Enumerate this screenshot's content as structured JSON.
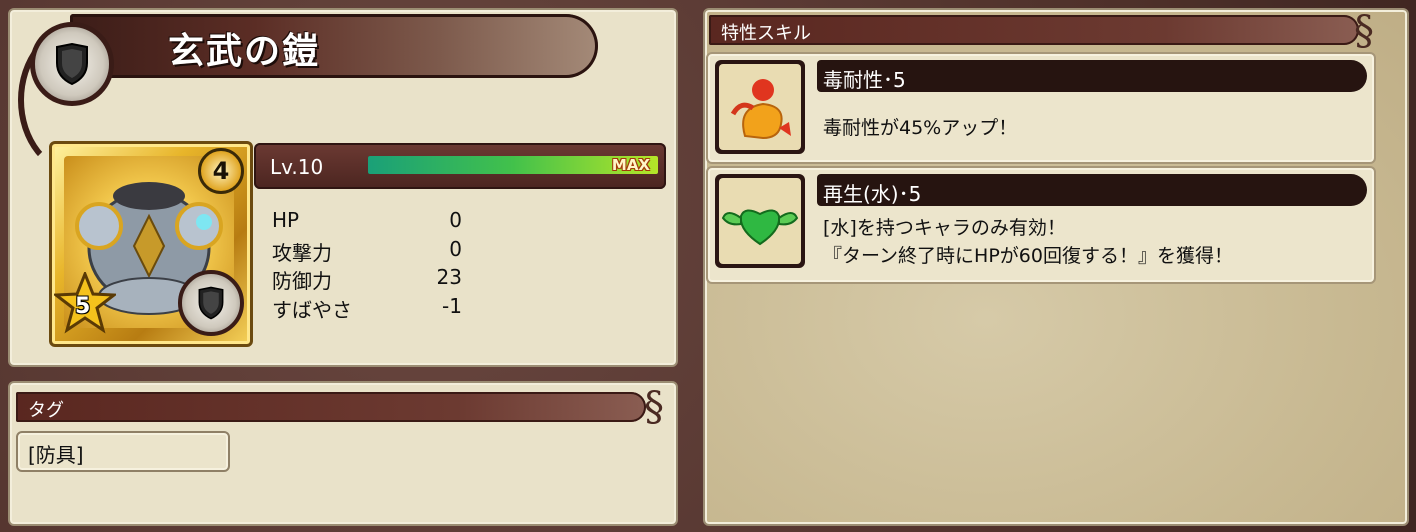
{
  "item": {
    "name": "玄武の鎧",
    "rarity": "4",
    "stars": "5",
    "level": "Lv.10",
    "xp_label": "MAX",
    "xp_fraction": 1.0,
    "stats": [
      {
        "label": "HP",
        "value": "0"
      },
      {
        "label": "攻撃力",
        "value": "0"
      },
      {
        "label": "防御力",
        "value": "23"
      },
      {
        "label": "すばやさ",
        "value": "-1"
      }
    ]
  },
  "tags": {
    "header": "タグ",
    "items": [
      "[防具]"
    ]
  },
  "skills": {
    "header": "特性スキル",
    "list": [
      {
        "title": "毒耐性･5",
        "desc": [
          "毒耐性が45%アップ！"
        ],
        "icon": "poison-resist-icon"
      },
      {
        "title": "再生(水)･5",
        "desc": [
          "[水]を持つキャラのみ有効！",
          "『ターン終了時にHPが60回復する！』を獲得！"
        ],
        "icon": "winged-heart-icon"
      }
    ]
  },
  "colors": {
    "panel": "#e9e2c9",
    "header": "#5a2720",
    "xp_start": "#1aa078",
    "xp_end": "#b6e628"
  }
}
